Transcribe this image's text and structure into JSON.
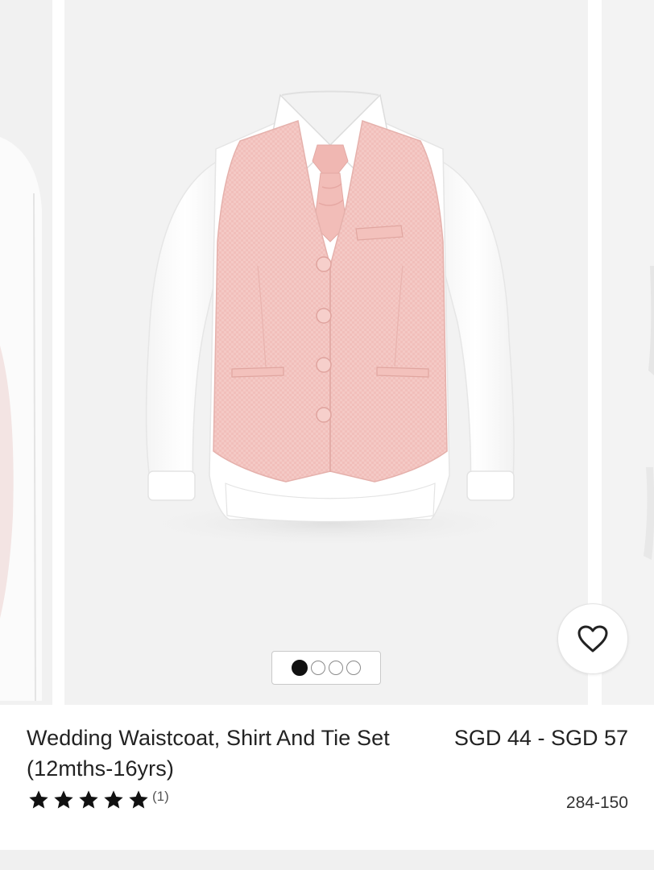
{
  "product": {
    "title": "Wedding Waistcoat, Shirt And Tie Set (12mths-16yrs)",
    "price": "SGD 44 - SGD 57",
    "rating_stars": 5,
    "review_count": "(1)",
    "item_code": "284-150"
  },
  "carousel": {
    "slide_count": 4,
    "active_index": 0
  },
  "icons": {
    "favourite": "heart-icon",
    "rating": "star-icon"
  },
  "colors": {
    "waistcoat": "#f4c7c3",
    "background": "#f2f2f2",
    "text": "#222222"
  }
}
